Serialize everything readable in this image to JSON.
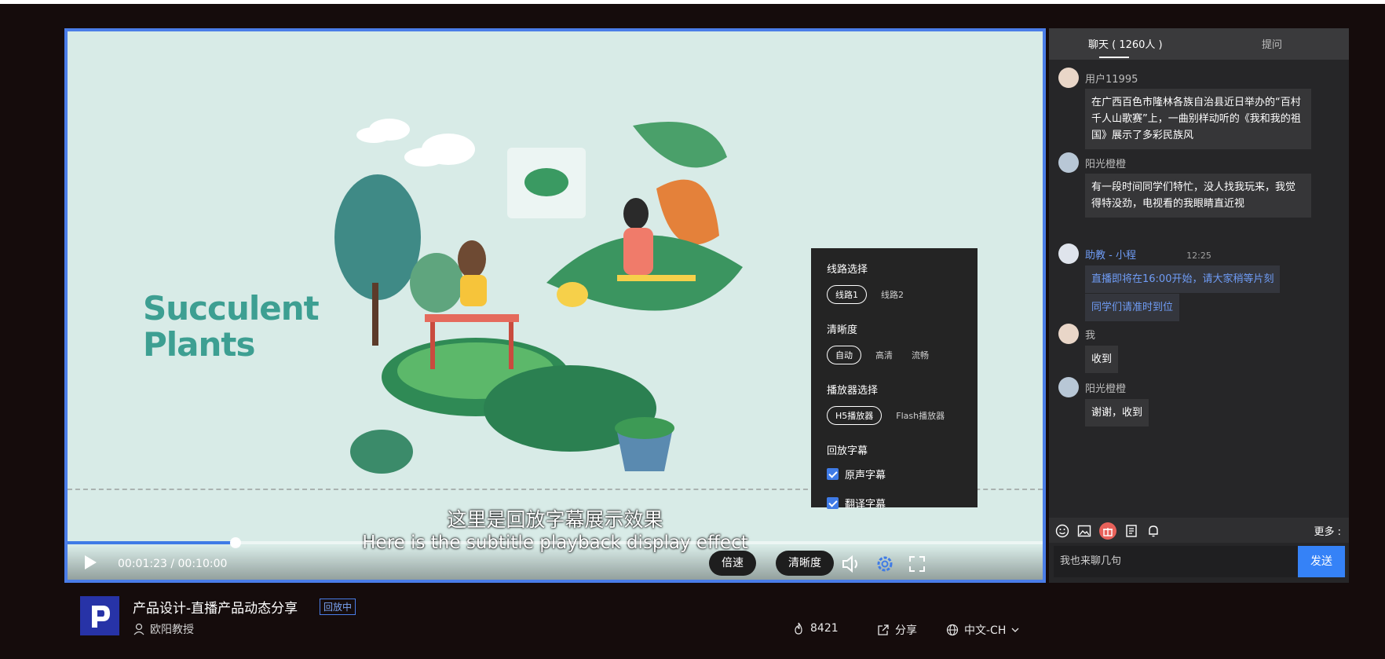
{
  "video": {
    "brand_title_line1": "Succulent",
    "brand_title_line2": "Plants",
    "subtitle_cn": "这里是回放字幕展示效果",
    "subtitle_en": "Here is the subtitle playback display effect",
    "progress_fraction": 0.172,
    "time_current": "00:01:23",
    "time_separator": "/",
    "time_total": "00:10:00",
    "speed_label": "倍速",
    "quality_label": "清晰度"
  },
  "settings": {
    "route_title": "线路选择",
    "routes": [
      "线路1",
      "线路2"
    ],
    "quality_title": "清晰度",
    "qualities": [
      "自动",
      "高清",
      "流畅"
    ],
    "player_title": "播放器选择",
    "players": [
      "H5播放器",
      "Flash播放器"
    ],
    "subtitle_title": "回放字幕",
    "subtitle_options": [
      "原声字幕",
      "翻译字幕"
    ]
  },
  "info": {
    "course_title": "产品设计-直播产品动态分享",
    "badge": "回放中",
    "teacher": "欧阳教授",
    "views": "8421",
    "share": "分享",
    "language": "中文-CH"
  },
  "chat": {
    "tab_chat": "聊天 ( 1260人 )",
    "tab_ask": "提问",
    "messages": [
      {
        "user": "用户11995",
        "text": "在广西百色市隆林各族自治县近日举办的“百村千人山歌赛”上，一曲别样动听的《我和我的祖国》展示了多彩民族风"
      },
      {
        "user": "阳光橙橙",
        "text": "有一段时间同学们特忙，没人找我玩来，我觉得特没劲，电视看的我眼睛直近视"
      },
      {
        "user": "助教 - 小程",
        "text": "直播即将在16:00开始，请大家稍等片刻",
        "text2": "同学们请准时到位"
      },
      {
        "user": "我",
        "text": "收到"
      },
      {
        "user": "阳光橙橙",
        "text": "谢谢，收到"
      }
    ],
    "time_divider": "12:25",
    "more": "更多 :",
    "input_placeholder": "我也来聊几句",
    "send": "发送"
  },
  "colors": {
    "accent": "#3f7be6",
    "frame_bg": "#150c0c",
    "video_bg": "#d8ebe7",
    "chat_bg": "#262628"
  }
}
